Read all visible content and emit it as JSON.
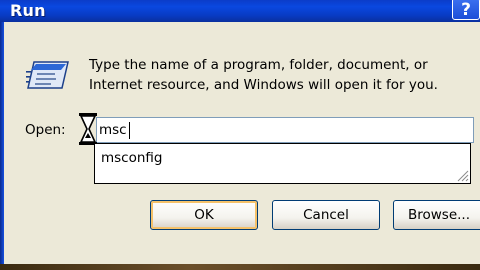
{
  "window": {
    "title": "Run",
    "help_label": "?"
  },
  "description": {
    "line1": "Type the name of a program, folder, document, or",
    "line2": "Internet resource, and Windows will open it for you."
  },
  "open_field": {
    "label": "Open:",
    "value": "msc"
  },
  "autocomplete": {
    "items": [
      "msconfig"
    ]
  },
  "buttons": {
    "ok": "OK",
    "cancel": "Cancel",
    "browse": "Browse..."
  },
  "icons": {
    "run": "run-icon",
    "cursor": "hourglass-icon",
    "grip": "resize-grip-icon"
  },
  "colors": {
    "titlebar": "#0a48e0",
    "dialog_bg": "#ece9d8",
    "default_button_highlight": "#f5c26a"
  }
}
